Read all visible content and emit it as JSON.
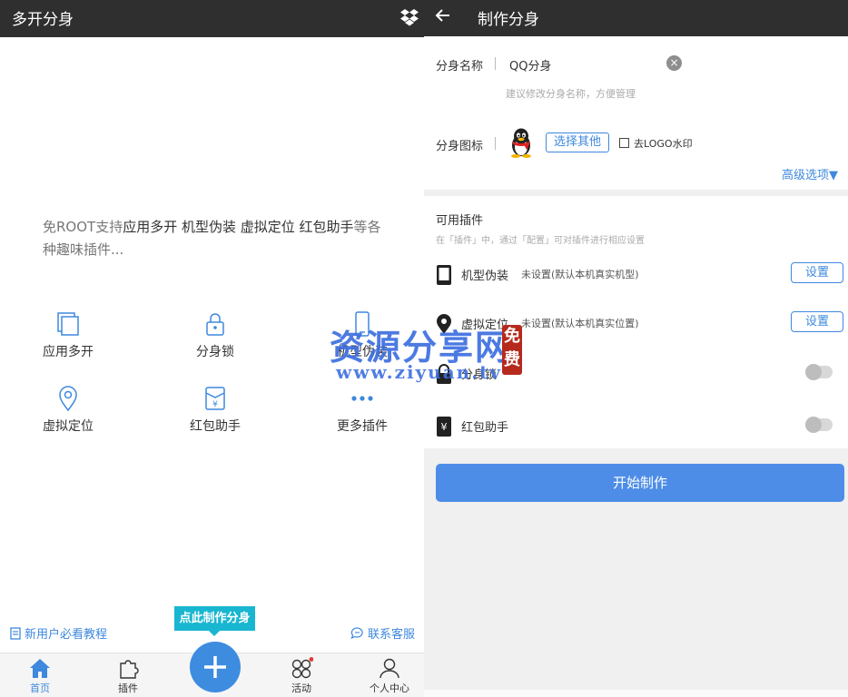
{
  "left": {
    "title": "多开分身",
    "intro_prefix": "免ROOT支持",
    "intro_highlight": "应用多开 机型伪装 虚拟定位 红包助手",
    "intro_suffix": "等各种趣味插件...",
    "features": [
      {
        "label": "应用多开",
        "icon": "copy-icon"
      },
      {
        "label": "分身锁",
        "icon": "lock-icon"
      },
      {
        "label": "机型伪装",
        "icon": "phone-icon"
      },
      {
        "label": "虚拟定位",
        "icon": "location-icon"
      },
      {
        "label": "红包助手",
        "icon": "red-packet-icon"
      },
      {
        "label": "更多插件",
        "icon": "more-icon"
      }
    ],
    "tutorial_link": "新用户必看教程",
    "support_link": "联系客服",
    "tip": "点此制作分身",
    "tabs": [
      {
        "label": "首页",
        "icon": "home-icon",
        "active": true
      },
      {
        "label": "插件",
        "icon": "puzzle-icon"
      },
      {
        "label": "活动",
        "icon": "activity-icon",
        "badge": true
      },
      {
        "label": "个人中心",
        "icon": "user-icon"
      }
    ]
  },
  "right": {
    "title": "制作分身",
    "name_label": "分身名称",
    "name_value": "QQ分身",
    "name_hint": "建议修改分身名称，方便管理",
    "icon_label": "分身图标",
    "choose_other": "选择其他",
    "remove_logo": "去LOGO水印",
    "advanced": "高级选项▼",
    "plugins_title": "可用插件",
    "plugins_subtitle": "在「插件」中，通过「配置」可对插件进行相应设置",
    "plugins": [
      {
        "name": "机型伪装",
        "desc": "未设置(默认本机真实机型)",
        "action": "设置",
        "icon": "phone-icon"
      },
      {
        "name": "虚拟定位",
        "desc": "未设置(默认本机真实位置)",
        "action": "设置",
        "icon": "location-icon"
      },
      {
        "name": "分身锁",
        "desc": "",
        "toggle": false,
        "icon": "lock-icon"
      },
      {
        "name": "红包助手",
        "desc": "",
        "toggle": false,
        "icon": "red-packet-icon"
      }
    ],
    "start_button": "开始制作"
  },
  "watermark": {
    "text": "资源分享网",
    "url": "www.ziyuan.tv",
    "seal": "免费"
  },
  "colors": {
    "accent": "#3e88de",
    "topbar": "#2f2f2f",
    "tip": "#19b6d1",
    "start_button": "#4d8de7"
  }
}
